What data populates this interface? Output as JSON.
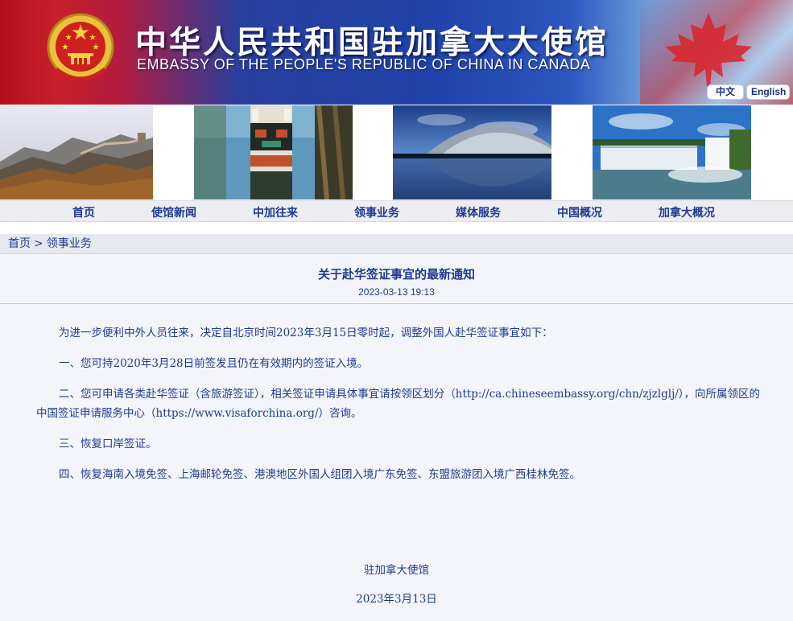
{
  "header": {
    "title_cn": "中华人民共和国驻加拿大大使馆",
    "title_en": "EMBASSY OF THE PEOPLE'S REPUBLIC OF CHINA IN CANADA",
    "lang_cn": "中文",
    "lang_en": "English"
  },
  "photos": [
    "great-wall",
    "totem-pole",
    "national-grand-theatre",
    "niagara-falls"
  ],
  "nav": {
    "items": [
      "首页",
      "使馆新闻",
      "中加往来",
      "领事业务",
      "媒体服务",
      "中国概况",
      "加拿大概况"
    ]
  },
  "breadcrumb": {
    "home": "首页",
    "sep": ">",
    "current": "领事业务"
  },
  "article": {
    "title": "关于赴华签证事宜的最新通知",
    "date": "2023-03-13 19:13",
    "paragraphs": [
      "为进一步便利中外人员往来，决定自北京时间2023年3月15日零时起，调整外国人赴华签证事宜如下：",
      "一、您可持2020年3月28日前签发且仍在有效期内的签证入境。",
      "二、您可申请各类赴华签证（含旅游签证），相关签证申请具体事宜请按领区划分（http://ca.chineseembassy.org/chn/zjzlglj/），向所属领区的中国签证申请服务中心（https://www.visaforchina.org/）咨询。",
      "三、恢复口岸签证。",
      "四、恢复海南入境免签、上海邮轮免签、港澳地区外国人组团入境广东免签、东盟旅游团入境广西桂林免签。"
    ],
    "signature": "驻加拿大使馆",
    "sign_date": "2023年3月13日"
  },
  "colors": {
    "link_blue": "#1c3a8f",
    "banner_red": "#c8202a",
    "banner_blue": "#1f43aa"
  }
}
